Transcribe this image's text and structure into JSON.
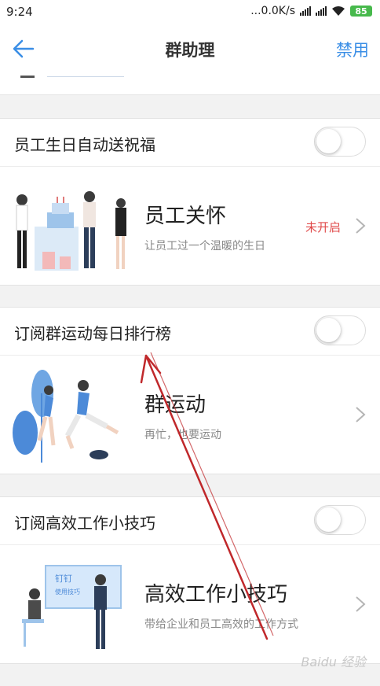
{
  "status_bar": {
    "time": "9:24",
    "network_speed": "...0.0K/s",
    "battery": "85"
  },
  "header": {
    "title": "群助理",
    "action_label": "禁用",
    "back_icon": "arrow-left-icon"
  },
  "sections": [
    {
      "toggle_label": "员工生日自动送祝福",
      "toggle_on": false,
      "card": {
        "title": "员工关怀",
        "description": "让员工过一个温暖的生日",
        "status": "未开启",
        "illustration": "birthday-party-illustration"
      }
    },
    {
      "toggle_label": "订阅群运动每日排行榜",
      "toggle_on": false,
      "card": {
        "title": "群运动",
        "description": "再忙，也要运动",
        "status": "",
        "illustration": "running-people-illustration"
      }
    },
    {
      "toggle_label": "订阅高效工作小技巧",
      "toggle_on": false,
      "card": {
        "title": "高效工作小技巧",
        "description": "带给企业和员工高效的工作方式",
        "status": "",
        "illustration": "presentation-illustration",
        "board_title": "钉钉",
        "board_subtitle": "使用技巧"
      }
    }
  ],
  "watermark": "Baidu 经验",
  "colors": {
    "accent": "#3a8ee6",
    "status_off": "#e04b4b",
    "annotation_arrow": "#c0282b"
  }
}
